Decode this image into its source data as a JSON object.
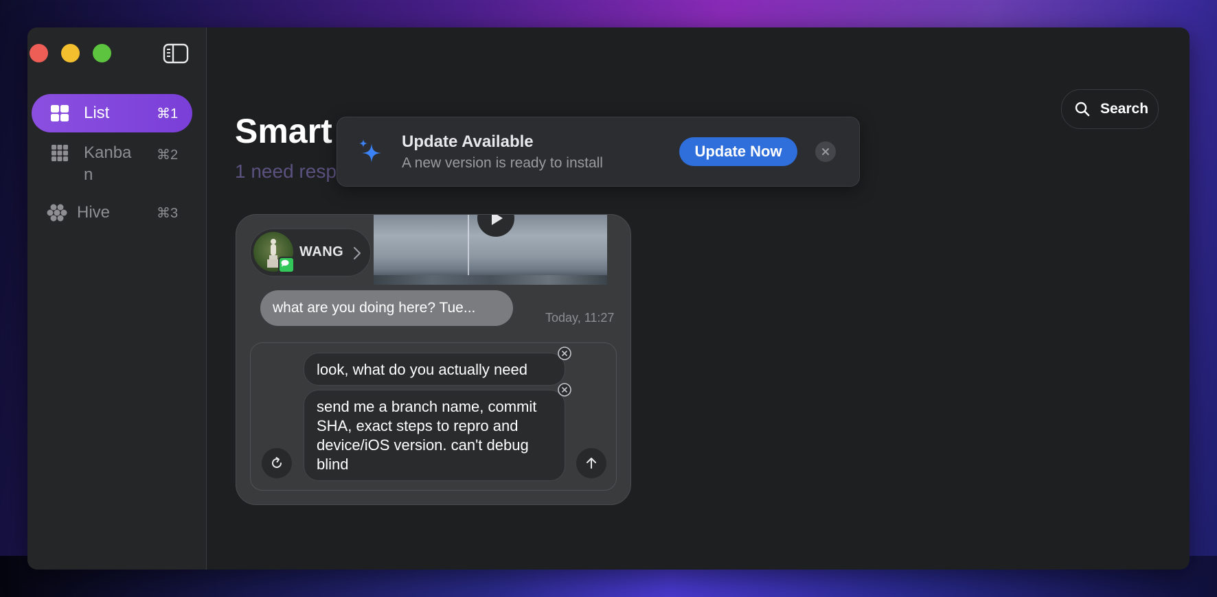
{
  "sidebar": {
    "items": [
      {
        "label": "List",
        "shortcut": "⌘1",
        "icon": "grid-2x2-icon",
        "active": true
      },
      {
        "label": "Kanban",
        "label_line1": "Kanba",
        "label_line2": "n",
        "shortcut": "⌘2",
        "icon": "grid-3x3-icon",
        "active": false
      },
      {
        "label": "Hive",
        "shortcut": "⌘3",
        "icon": "hive-icon",
        "active": false
      }
    ]
  },
  "header": {
    "title": "Smart",
    "subtitle": "1 need resp",
    "search_label": "Search"
  },
  "toast": {
    "title": "Update Available",
    "subtitle": "A new version is ready to install",
    "action_label": "Update Now"
  },
  "card": {
    "contact_name": "WANG",
    "incoming_message": "what are you doing here? Tue...",
    "timestamp": "Today, 11:27",
    "drafts": [
      "look, what do you actually need",
      "send me a branch name, commit SHA, exact steps to repro and device/iOS version. can't debug blind"
    ]
  },
  "colors": {
    "accent_purple": "#8b4fe0",
    "update_blue": "#2f6fdb",
    "imessage_green": "#33c759"
  }
}
